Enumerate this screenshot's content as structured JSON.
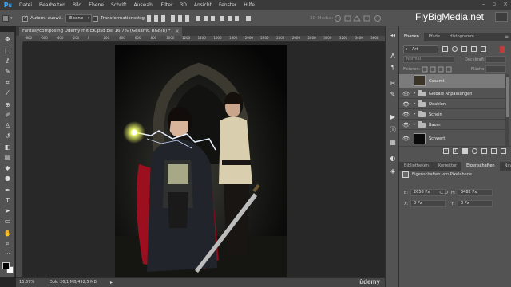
{
  "app": {
    "logo": "Ps"
  },
  "menu": [
    "Datei",
    "Bearbeiten",
    "Bild",
    "Ebene",
    "Schrift",
    "Auswahl",
    "Filter",
    "3D",
    "Ansicht",
    "Fenster",
    "Hilfe"
  ],
  "window_controls": {
    "minimize": "–",
    "restore": "▫",
    "close": "×"
  },
  "options": {
    "autoselect_label": "Autom. auswä.",
    "autoselect_checked": true,
    "autoselect_target": "Ebene",
    "transform_label": "Transformationsstrg.",
    "transform_checked": false,
    "mode3d": "3D-Modus:"
  },
  "watermark": "FlyBigMedia.net",
  "document": {
    "tab_title": "Fantasycomposing Udemy mit EK.psd bei 16,7% (Gesamt, RGB/8) *",
    "close": "×"
  },
  "ruler_ticks": [
    "-800",
    "-600",
    "-400",
    "-200",
    "0",
    "200",
    "400",
    "600",
    "800",
    "1000",
    "1200",
    "1400",
    "1600",
    "1800",
    "2000",
    "2200",
    "2400",
    "2600",
    "2800",
    "3000",
    "3200",
    "3400",
    "3600"
  ],
  "status": {
    "zoom": "16,67%",
    "doc_size": "Dok: 26,1 MB/492,5 MB",
    "arrow": "▸",
    "brand": "ūdemy"
  },
  "layers_panel": {
    "tabs": [
      "Ebenen",
      "Pfade",
      "Histogramm"
    ],
    "menu_icon": "≡",
    "filter_kind": "Art",
    "blend_mode": "Normal",
    "opacity_label": "Deckkraft:",
    "lock_label": "Fixieren:",
    "fill_label": "Fläche:",
    "layers": [
      {
        "name": "Gesamt",
        "type": "smart",
        "selected": true,
        "visible": false
      },
      {
        "name": "Globale Anpassungen",
        "type": "group",
        "selected": false,
        "visible": true
      },
      {
        "name": "Strahlen",
        "type": "group",
        "selected": false,
        "visible": true
      },
      {
        "name": "Schein",
        "type": "group",
        "selected": false,
        "visible": true
      },
      {
        "name": "Baum",
        "type": "group",
        "selected": false,
        "visible": true
      },
      {
        "name": "Schwert",
        "type": "layer",
        "selected": false,
        "visible": true
      }
    ]
  },
  "properties_panel": {
    "tabs": [
      "Bibliotheken",
      "Korrektur",
      "Eigenschaften",
      "Navigator"
    ],
    "header": "Eigenschaften von Pixelebene",
    "width_label": "B:",
    "width": "2656 Px",
    "height_label": "H:",
    "height": "3482 Px",
    "x_label": "X:",
    "x": "0 Px",
    "y_label": "Y:",
    "y": "0 Px"
  },
  "colors": {
    "accent": "#31a8ff",
    "selection": "#7b7b7b",
    "panel": "#535353",
    "red_cloak": "#c0102a"
  }
}
